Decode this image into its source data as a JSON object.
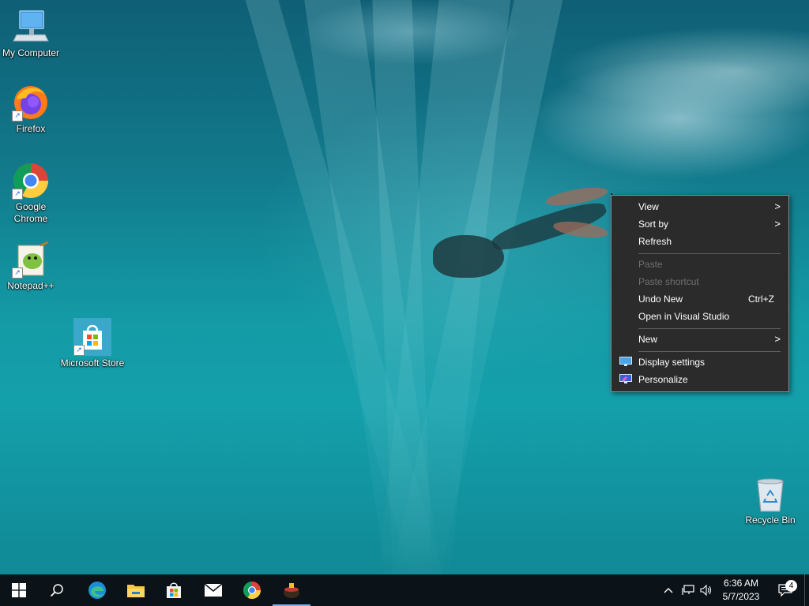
{
  "desktop_icons": [
    {
      "label": "My Computer",
      "icon": "computer-icon"
    },
    {
      "label": "Firefox",
      "icon": "firefox-icon"
    },
    {
      "label": "Google Chrome",
      "icon": "chrome-icon"
    },
    {
      "label": "Notepad++",
      "icon": "notepad-plus-plus-icon"
    },
    {
      "label": "Microsoft Store",
      "icon": "store-icon"
    },
    {
      "label": "Recycle Bin",
      "icon": "recycle-bin-icon"
    }
  ],
  "context_menu": {
    "items": [
      {
        "label": "View",
        "submenu": true
      },
      {
        "label": "Sort by",
        "submenu": true
      },
      {
        "label": "Refresh"
      },
      {
        "label": "Paste",
        "disabled": true
      },
      {
        "label": "Paste shortcut",
        "disabled": true
      },
      {
        "label": "Undo New",
        "shortcut": "Ctrl+Z"
      },
      {
        "label": "Open in Visual Studio"
      },
      {
        "label": "New",
        "submenu": true
      },
      {
        "label": "Display settings",
        "icon": "display-icon"
      },
      {
        "label": "Personalize",
        "icon": "personalize-icon"
      }
    ],
    "submenu_glyph": ">"
  },
  "taskbar": {
    "apps": [
      "start-icon",
      "search-icon",
      "edge-icon",
      "file-explorer-icon",
      "store-icon",
      "mail-icon",
      "chrome-icon",
      "app-icon"
    ],
    "clock": {
      "time": "6:36 AM",
      "date": "5/7/2023"
    },
    "notification_count": "4",
    "tray_chevron": "^"
  },
  "colors": {
    "menu_bg": "#2b2b2b",
    "taskbar_bg": "#0c1318",
    "accent": "#78b7f0"
  }
}
